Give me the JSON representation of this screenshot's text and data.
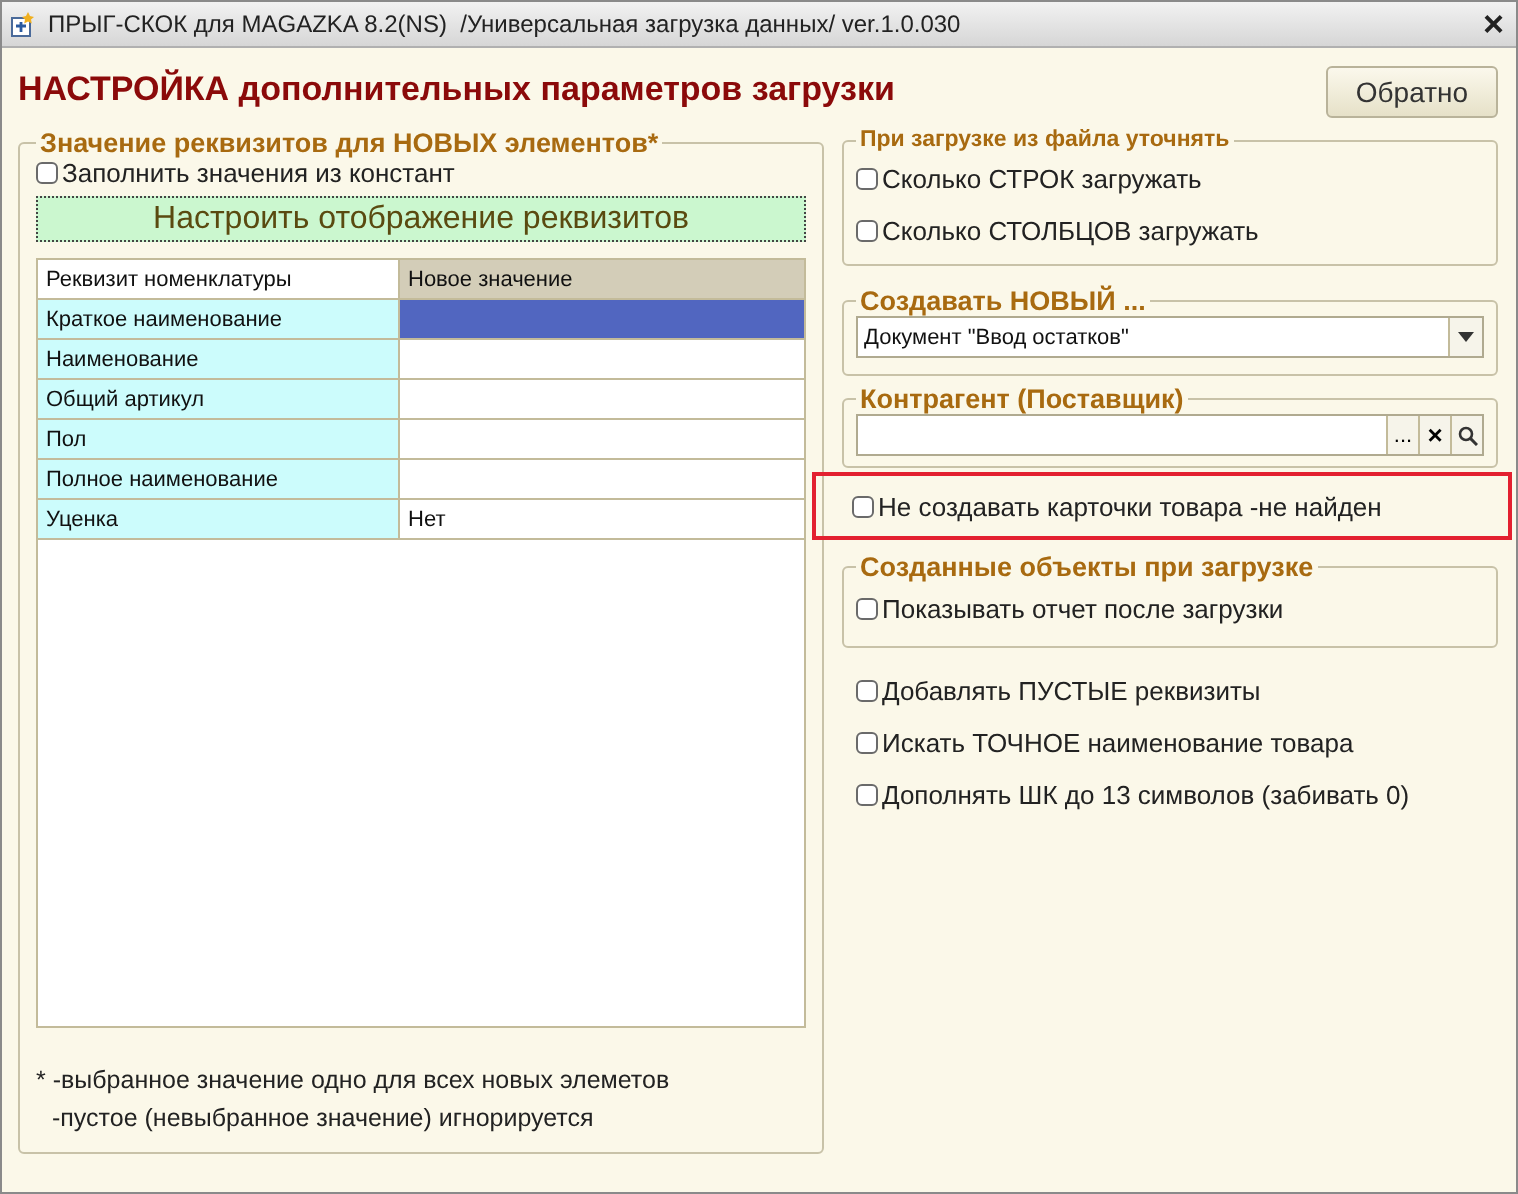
{
  "window": {
    "title": "ПРЫГ-СКОК для MAGAZKA 8.2(NS)  /Универсальная загрузка данных/ ver.1.0.030",
    "close": "×"
  },
  "header": {
    "title": "НАСТРОЙКА дополнительных параметров загрузки",
    "back_button": "Обратно"
  },
  "left_group": {
    "title": "Значение реквизитов для НОВЫХ элементов*",
    "fill_from_constants": {
      "label": "Заполнить значения из констант",
      "checked": false
    },
    "configure_button": "Настроить отображение реквизитов",
    "table": {
      "columns": [
        "Реквизит номенклатуры",
        "Новое значение"
      ],
      "rows": [
        {
          "attribute": "Краткое наименование",
          "selected": true
        },
        {
          "attribute": "Наименование",
          "selected": false
        },
        {
          "attribute": "Общий артикул",
          "selected": false
        },
        {
          "attribute": "Пол",
          "selected": false
        },
        {
          "attribute": "Полное наименование",
          "selected": false
        },
        {
          "attribute": "Уценка",
          "value": "Нет",
          "selected": false
        }
      ]
    },
    "notes": [
      "* -выбранное значение одно для всех новых элеметов",
      "-пустое (невыбранное значение) игнорируется"
    ]
  },
  "file_group": {
    "title": "При загрузке из файла уточнять",
    "options": [
      {
        "label": "Сколько СТРОК загружать",
        "checked": false
      },
      {
        "label": "Сколько СТОЛБЦОВ загружать",
        "checked": false
      }
    ]
  },
  "create_group": {
    "title": "Создавать НОВЫЙ ...",
    "value": "Документ \"Ввод остатков\""
  },
  "counterparty_group": {
    "title": "Контрагент (Поставщик)",
    "select_button": "...",
    "clear_button": "×"
  },
  "highlighted_option": {
    "label": "Не создавать карточки товара -не найден",
    "checked": false
  },
  "created_group": {
    "title": "Созданные объекты при загрузке",
    "options": [
      {
        "label": "Показывать отчет после загрузки",
        "checked": false
      }
    ]
  },
  "options": [
    {
      "label": "Добавлять ПУСТЫЕ реквизиты",
      "checked": false
    },
    {
      "label": "Искать ТОЧНОЕ наименование товара",
      "checked": false
    },
    {
      "label": "Дополнять ШК до 13 символов (забивать 0)",
      "checked": false
    }
  ]
}
